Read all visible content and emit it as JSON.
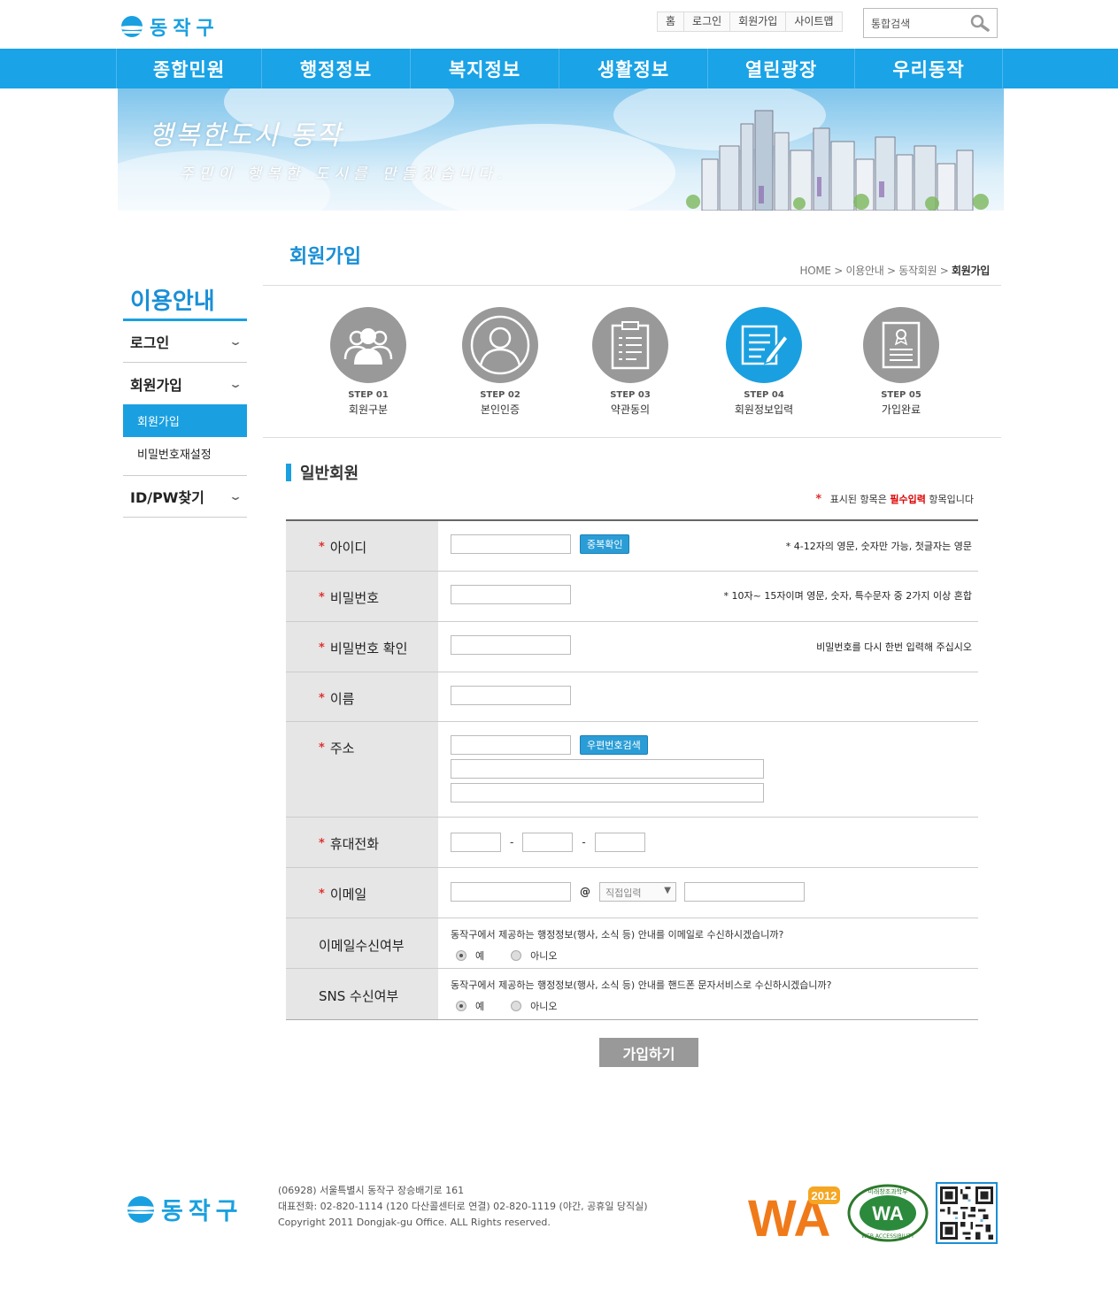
{
  "header": {
    "logo_text": "동작구",
    "util_links": [
      "홈",
      "로그인",
      "회원가입",
      "사이트맵"
    ],
    "search_value": "통합검색"
  },
  "gnb": [
    "종합민원",
    "행정정보",
    "복지정보",
    "생활정보",
    "열린광장",
    "우리동작"
  ],
  "banner": {
    "title": "행복한도시 동작",
    "subtitle": "주민이 행복한 도시를 만들겠습니다."
  },
  "lnb": {
    "title": "이용안내",
    "items": [
      {
        "label": "로그인"
      },
      {
        "label": "회원가입",
        "subs": [
          "회원가입",
          "비밀번호재설정"
        ]
      },
      {
        "label": "ID/PW찾기"
      }
    ]
  },
  "page": {
    "title": "회원가입",
    "breadcrumb": [
      "HOME",
      "이용안내",
      "동작회원",
      "회원가입"
    ]
  },
  "steps": [
    {
      "no": "STEP 01",
      "label": "회원구분",
      "icon": "users-icon",
      "active": false
    },
    {
      "no": "STEP 02",
      "label": "본인인증",
      "icon": "user-icon",
      "active": false
    },
    {
      "no": "STEP 03",
      "label": "약관동의",
      "icon": "clipboard-icon",
      "active": false
    },
    {
      "no": "STEP 04",
      "label": "회원정보입력",
      "icon": "edit-document-icon",
      "active": true
    },
    {
      "no": "STEP 05",
      "label": "가입완료",
      "icon": "certificate-icon",
      "active": false
    }
  ],
  "form": {
    "section_title": "일반회원",
    "required_note": {
      "star": "*",
      "pre": "표시된 항목은 ",
      "emph": "필수입력",
      "post": " 항목입니다"
    },
    "fields": {
      "id": {
        "label": "아이디",
        "button": "중복확인",
        "hint": "* 4-12자의 영문, 숫자만 가능, 첫글자는 영문"
      },
      "pw": {
        "label": "비밀번호",
        "hint": "* 10자~ 15자이며 영문, 숫자, 특수문자 중 2가지 이상 혼합"
      },
      "pw_confirm": {
        "label": "비밀번호 확인",
        "hint": "비밀번호를 다시 한번 입력해 주십시오"
      },
      "name": {
        "label": "이름"
      },
      "address": {
        "label": "주소",
        "button": "우편번호검색"
      },
      "mobile": {
        "label": "휴대전화",
        "sep": "-"
      },
      "email": {
        "label": "이메일",
        "at": "@",
        "domain_select": "직접입력"
      },
      "email_opt": {
        "label": "이메일수신여부",
        "question": "동작구에서 제공하는 행정정보(행사, 소식 등) 안내를 이메일로 수신하시겠습니까?",
        "yes": "예",
        "no": "아니오"
      },
      "sns_opt": {
        "label": "SNS 수신여부",
        "question": "동작구에서 제공하는 행정정보(행사, 소식 등) 안내를 핸드폰 문자서비스로 수신하시겠습니까?",
        "yes": "예",
        "no": "아니오"
      }
    },
    "submit": "가입하기"
  },
  "footer": {
    "logo_text": "동작구",
    "address": "(06928) 서울특별시 동작구 장승배기로 161",
    "phone": "대표전화: 02-820-1114 (120 다산콜센터로 연결) 02-820-1119 (야간, 공휴일 당직실)",
    "copyright": "Copyright 2011 Dongjak-gu Office. ALL Rights reserved.",
    "badges": {
      "wa_text": "WA",
      "wa_year": "2012",
      "wa2_top": "미래창조과학부",
      "wa2_bottom": "WEB ACCESSIBILITY"
    }
  },
  "colors": {
    "primary": "#1aa3e6",
    "accent_red": "#e03030",
    "step_gray": "#999999"
  }
}
